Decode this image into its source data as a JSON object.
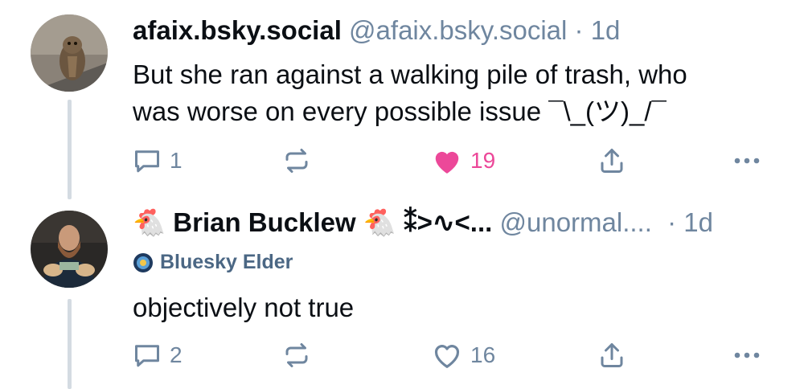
{
  "posts": [
    {
      "display_name": "afaix.bsky.social",
      "handle": "@afaix.bsky.social",
      "time": "· 1d",
      "text_line1": "But she ran against a walking pile of trash, who",
      "text_line2": "was worse on every possible issue ¯\\_(ツ)_/¯",
      "replies": "1",
      "likes": "19",
      "liked": true
    },
    {
      "name_prefix_emoji": "🐔",
      "display_name": "Brian Bucklew",
      "name_suffix": "🐔 ⁑>∿<...",
      "handle": "@unormal....",
      "time": "· 1d",
      "badge": "Bluesky Elder",
      "text": "objectively not true",
      "replies": "2",
      "likes": "16",
      "liked": false
    }
  ],
  "colors": {
    "muted": "#6f869f",
    "like_active": "#ec4899",
    "thread_line": "#d4dbe2"
  },
  "icons": [
    "reply-icon",
    "repost-icon",
    "like-icon",
    "share-icon",
    "more-icon",
    "chicken-icon",
    "badge-icon"
  ]
}
